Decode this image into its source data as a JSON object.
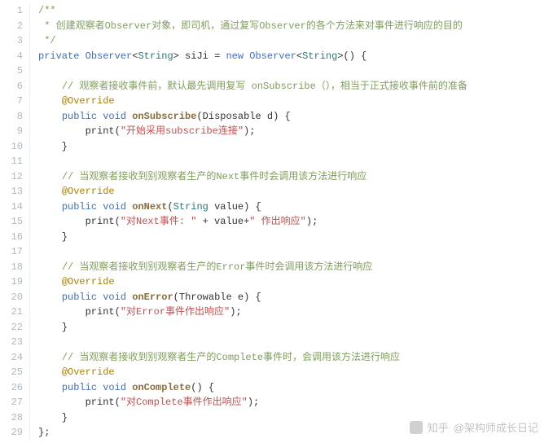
{
  "lines": [
    {
      "n": 1,
      "t": [
        {
          "c": "c-comment",
          "x": "/**"
        }
      ]
    },
    {
      "n": 2,
      "t": [
        {
          "c": "c-comment",
          "x": " * 创建观察者Observer对象，即司机，通过复写Observer的各个方法来对事件进行响应的目的"
        }
      ]
    },
    {
      "n": 3,
      "t": [
        {
          "c": "c-comment",
          "x": " */"
        }
      ]
    },
    {
      "n": 4,
      "t": [
        {
          "c": "c-key",
          "x": "private"
        },
        {
          "c": "",
          "x": " "
        },
        {
          "c": "c-type",
          "x": "Observer"
        },
        {
          "c": "",
          "x": "<"
        },
        {
          "c": "c-gen",
          "x": "String"
        },
        {
          "c": "",
          "x": "> siJi = "
        },
        {
          "c": "c-key",
          "x": "new"
        },
        {
          "c": "",
          "x": " "
        },
        {
          "c": "c-type",
          "x": "Observer"
        },
        {
          "c": "",
          "x": "<"
        },
        {
          "c": "c-gen",
          "x": "String"
        },
        {
          "c": "",
          "x": ">() {"
        }
      ]
    },
    {
      "n": 5,
      "t": []
    },
    {
      "n": 6,
      "t": [
        {
          "c": "",
          "x": "    "
        },
        {
          "c": "c-comment",
          "x": "// 观察者接收事件前，默认最先调用复写 onSubscribe（），相当于正式接收事件前的准备"
        }
      ]
    },
    {
      "n": 7,
      "t": [
        {
          "c": "",
          "x": "    "
        },
        {
          "c": "c-ann",
          "x": "@Override"
        }
      ]
    },
    {
      "n": 8,
      "t": [
        {
          "c": "",
          "x": "    "
        },
        {
          "c": "c-key",
          "x": "public"
        },
        {
          "c": "",
          "x": " "
        },
        {
          "c": "c-key",
          "x": "void"
        },
        {
          "c": "",
          "x": " "
        },
        {
          "c": "c-method",
          "x": "onSubscribe"
        },
        {
          "c": "",
          "x": "(Disposable d) {"
        }
      ]
    },
    {
      "n": 9,
      "t": [
        {
          "c": "",
          "x": "        print("
        },
        {
          "c": "c-string",
          "x": "\"开始采用subscribe连接\""
        },
        {
          "c": "",
          "x": ");"
        }
      ]
    },
    {
      "n": 10,
      "t": [
        {
          "c": "",
          "x": "    }"
        }
      ]
    },
    {
      "n": 11,
      "t": []
    },
    {
      "n": 12,
      "t": [
        {
          "c": "",
          "x": "    "
        },
        {
          "c": "c-comment",
          "x": "// 当观察者接收到别观察者生产的Next事件时会调用该方法进行响应"
        }
      ]
    },
    {
      "n": 13,
      "t": [
        {
          "c": "",
          "x": "    "
        },
        {
          "c": "c-ann",
          "x": "@Override"
        }
      ]
    },
    {
      "n": 14,
      "t": [
        {
          "c": "",
          "x": "    "
        },
        {
          "c": "c-key",
          "x": "public"
        },
        {
          "c": "",
          "x": " "
        },
        {
          "c": "c-key",
          "x": "void"
        },
        {
          "c": "",
          "x": " "
        },
        {
          "c": "c-method",
          "x": "onNext"
        },
        {
          "c": "",
          "x": "("
        },
        {
          "c": "c-gen",
          "x": "String"
        },
        {
          "c": "",
          "x": " value) {"
        }
      ]
    },
    {
      "n": 15,
      "t": [
        {
          "c": "",
          "x": "        print("
        },
        {
          "c": "c-string",
          "x": "\"对Next事件: \""
        },
        {
          "c": "",
          "x": " + value+"
        },
        {
          "c": "c-string",
          "x": "\" 作出响应\""
        },
        {
          "c": "",
          "x": ");"
        }
      ]
    },
    {
      "n": 16,
      "t": [
        {
          "c": "",
          "x": "    }"
        }
      ]
    },
    {
      "n": 17,
      "t": []
    },
    {
      "n": 18,
      "t": [
        {
          "c": "",
          "x": "    "
        },
        {
          "c": "c-comment",
          "x": "// 当观察者接收到别观察者生产的Error事件时会调用该方法进行响应"
        }
      ]
    },
    {
      "n": 19,
      "t": [
        {
          "c": "",
          "x": "    "
        },
        {
          "c": "c-ann",
          "x": "@Override"
        }
      ]
    },
    {
      "n": 20,
      "t": [
        {
          "c": "",
          "x": "    "
        },
        {
          "c": "c-key",
          "x": "public"
        },
        {
          "c": "",
          "x": " "
        },
        {
          "c": "c-key",
          "x": "void"
        },
        {
          "c": "",
          "x": " "
        },
        {
          "c": "c-method",
          "x": "onError"
        },
        {
          "c": "",
          "x": "(Throwable e) {"
        }
      ]
    },
    {
      "n": 21,
      "t": [
        {
          "c": "",
          "x": "        print("
        },
        {
          "c": "c-string",
          "x": "\"对Error事件作出响应\""
        },
        {
          "c": "",
          "x": ");"
        }
      ]
    },
    {
      "n": 22,
      "t": [
        {
          "c": "",
          "x": "    }"
        }
      ]
    },
    {
      "n": 23,
      "t": []
    },
    {
      "n": 24,
      "t": [
        {
          "c": "",
          "x": "    "
        },
        {
          "c": "c-comment",
          "x": "// 当观察者接收到别观察者生产的Complete事件时，会调用该方法进行响应"
        }
      ]
    },
    {
      "n": 25,
      "t": [
        {
          "c": "",
          "x": "    "
        },
        {
          "c": "c-ann",
          "x": "@Override"
        }
      ]
    },
    {
      "n": 26,
      "t": [
        {
          "c": "",
          "x": "    "
        },
        {
          "c": "c-key",
          "x": "public"
        },
        {
          "c": "",
          "x": " "
        },
        {
          "c": "c-key",
          "x": "void"
        },
        {
          "c": "",
          "x": " "
        },
        {
          "c": "c-method",
          "x": "onComplete"
        },
        {
          "c": "",
          "x": "() {"
        }
      ]
    },
    {
      "n": 27,
      "t": [
        {
          "c": "",
          "x": "        print("
        },
        {
          "c": "c-string",
          "x": "\"对Complete事件作出响应\""
        },
        {
          "c": "",
          "x": ");"
        }
      ]
    },
    {
      "n": 28,
      "t": [
        {
          "c": "",
          "x": "    }"
        }
      ]
    },
    {
      "n": 29,
      "t": [
        {
          "c": "",
          "x": "};"
        }
      ]
    }
  ],
  "watermark": {
    "brand": "知乎",
    "author": "@架构师成长日记"
  }
}
